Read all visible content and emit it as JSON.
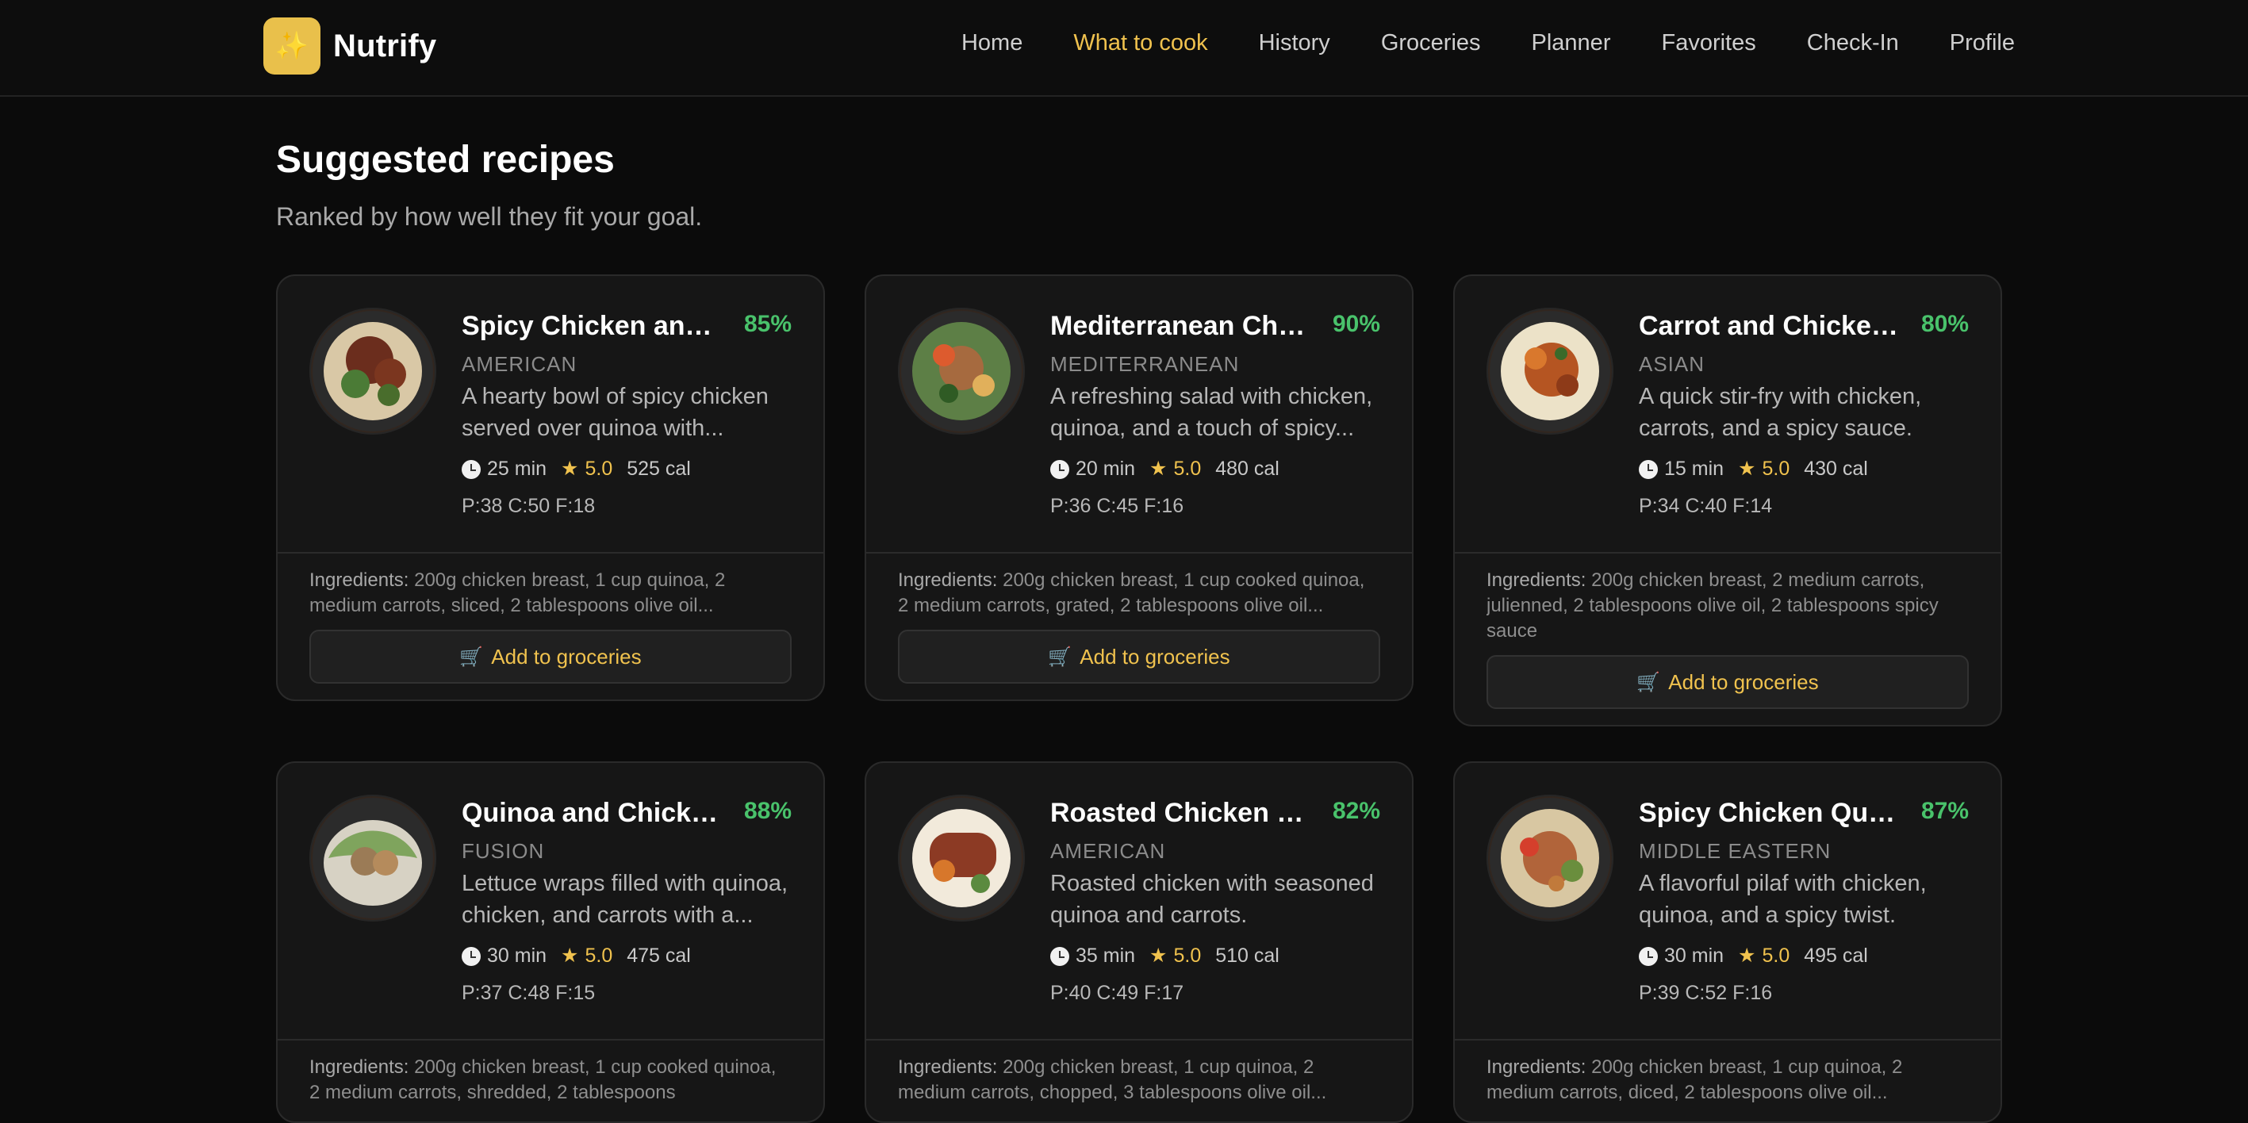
{
  "app": {
    "name": "Nutrify",
    "logo_icon": "sparkles-icon",
    "accent": "#f0c24e",
    "match_color": "#49c26b"
  },
  "nav": {
    "items": [
      {
        "label": "Home",
        "active": false
      },
      {
        "label": "What to cook",
        "active": true
      },
      {
        "label": "History",
        "active": false
      },
      {
        "label": "Groceries",
        "active": false
      },
      {
        "label": "Planner",
        "active": false
      },
      {
        "label": "Favorites",
        "active": false
      },
      {
        "label": "Check-In",
        "active": false
      },
      {
        "label": "Profile",
        "active": false
      }
    ]
  },
  "header": {
    "title": "Suggested recipes",
    "subtitle": "Ranked by how well they fit your goal."
  },
  "ui": {
    "ingredients_label": "Ingredients:",
    "add_groceries": "Add to groceries",
    "star_glyph": "★",
    "cart_glyph": "🛒"
  },
  "recipes": [
    {
      "title": "Spicy Chicken and ...",
      "match": "85%",
      "cuisine": "AMERICAN",
      "description": "A hearty bowl of spicy chicken served over quinoa with...",
      "time": "25 min",
      "rating": "5.0",
      "calories": "525 cal",
      "macros": "P:38 C:50 F:18",
      "ingredients": "200g chicken breast, 1 cup quinoa, 2 medium carrots, sliced, 2 tablespoons olive oil..."
    },
    {
      "title": "Mediterranean Chic...",
      "match": "90%",
      "cuisine": "MEDITERRANEAN",
      "description": "A refreshing salad with chicken, quinoa, and a touch of spicy...",
      "time": "20 min",
      "rating": "5.0",
      "calories": "480 cal",
      "macros": "P:36 C:45 F:16",
      "ingredients": "200g chicken breast, 1 cup cooked quinoa, 2 medium carrots, grated, 2 tablespoons olive oil..."
    },
    {
      "title": "Carrot and Chicken ...",
      "match": "80%",
      "cuisine": "ASIAN",
      "description": "A quick stir-fry with chicken, carrots, and a spicy sauce.",
      "time": "15 min",
      "rating": "5.0",
      "calories": "430 cal",
      "macros": "P:34 C:40 F:14",
      "ingredients": "200g chicken breast, 2 medium carrots, julienned, 2 tablespoons olive oil, 2 tablespoons spicy sauce"
    },
    {
      "title": "Quinoa and Chicken...",
      "match": "88%",
      "cuisine": "FUSION",
      "description": "Lettuce wraps filled with quinoa, chicken, and carrots with a...",
      "time": "30 min",
      "rating": "5.0",
      "calories": "475 cal",
      "macros": "P:37 C:48 F:15",
      "ingredients": "200g chicken breast, 1 cup cooked quinoa, 2 medium carrots, shredded, 2 tablespoons"
    },
    {
      "title": "Roasted Chicken an...",
      "match": "82%",
      "cuisine": "AMERICAN",
      "description": "Roasted chicken with seasoned quinoa and carrots.",
      "time": "35 min",
      "rating": "5.0",
      "calories": "510 cal",
      "macros": "P:40 C:49 F:17",
      "ingredients": "200g chicken breast, 1 cup quinoa, 2 medium carrots, chopped, 3 tablespoons olive oil..."
    },
    {
      "title": "Spicy Chicken Quin...",
      "match": "87%",
      "cuisine": "MIDDLE EASTERN",
      "description": "A flavorful pilaf with chicken, quinoa, and a spicy twist.",
      "time": "30 min",
      "rating": "5.0",
      "calories": "495 cal",
      "macros": "P:39 C:52 F:16",
      "ingredients": "200g chicken breast, 1 cup quinoa, 2 medium carrots, diced, 2 tablespoons olive oil..."
    }
  ]
}
